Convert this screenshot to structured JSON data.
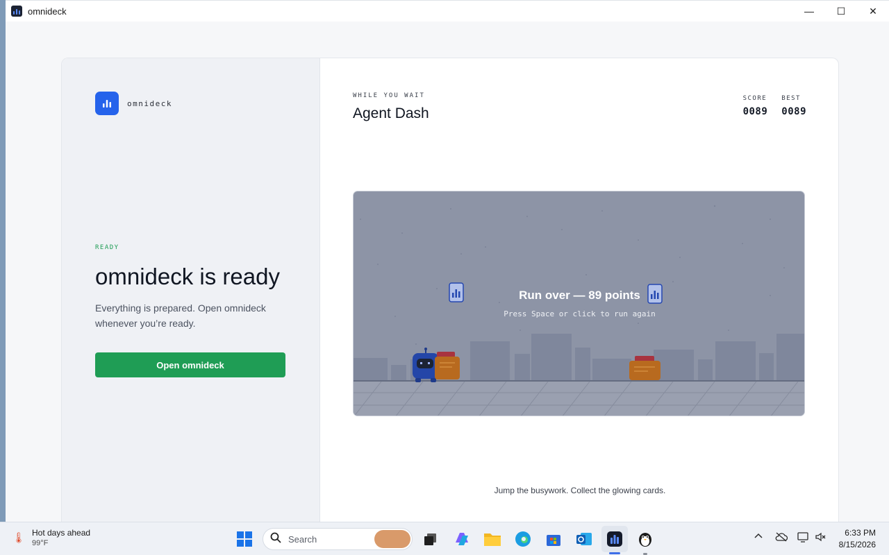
{
  "window": {
    "title": "omnideck",
    "controls": {
      "minimize": "—",
      "maximize": "☐",
      "close": "✕"
    }
  },
  "left_pane": {
    "brand_name": "omnideck",
    "status_label": "READY",
    "heading": "omnideck is ready",
    "description": "Everything is prepared. Open omnideck whenever you’re ready.",
    "open_button_label": "Open omnideck"
  },
  "right_pane": {
    "eyebrow": "WHILE YOU WAIT",
    "game_title": "Agent Dash",
    "score_label": "SCORE",
    "score_value": "0089",
    "best_label": "BEST",
    "best_value": "0089",
    "overlay_title": "Run over — 89 points",
    "overlay_subtitle": "Press Space or click to run again",
    "hint": "Jump the busywork. Collect the glowing cards."
  },
  "taskbar": {
    "weather_title": "Hot days ahead",
    "weather_temp": "99°F",
    "search_placeholder": "Search",
    "time": "6:33 PM",
    "date": "8/15/2026"
  },
  "colors": {
    "accent_blue": "#2563eb",
    "ready_green": "#1f9d55",
    "game_bg": "#8d94a6"
  }
}
